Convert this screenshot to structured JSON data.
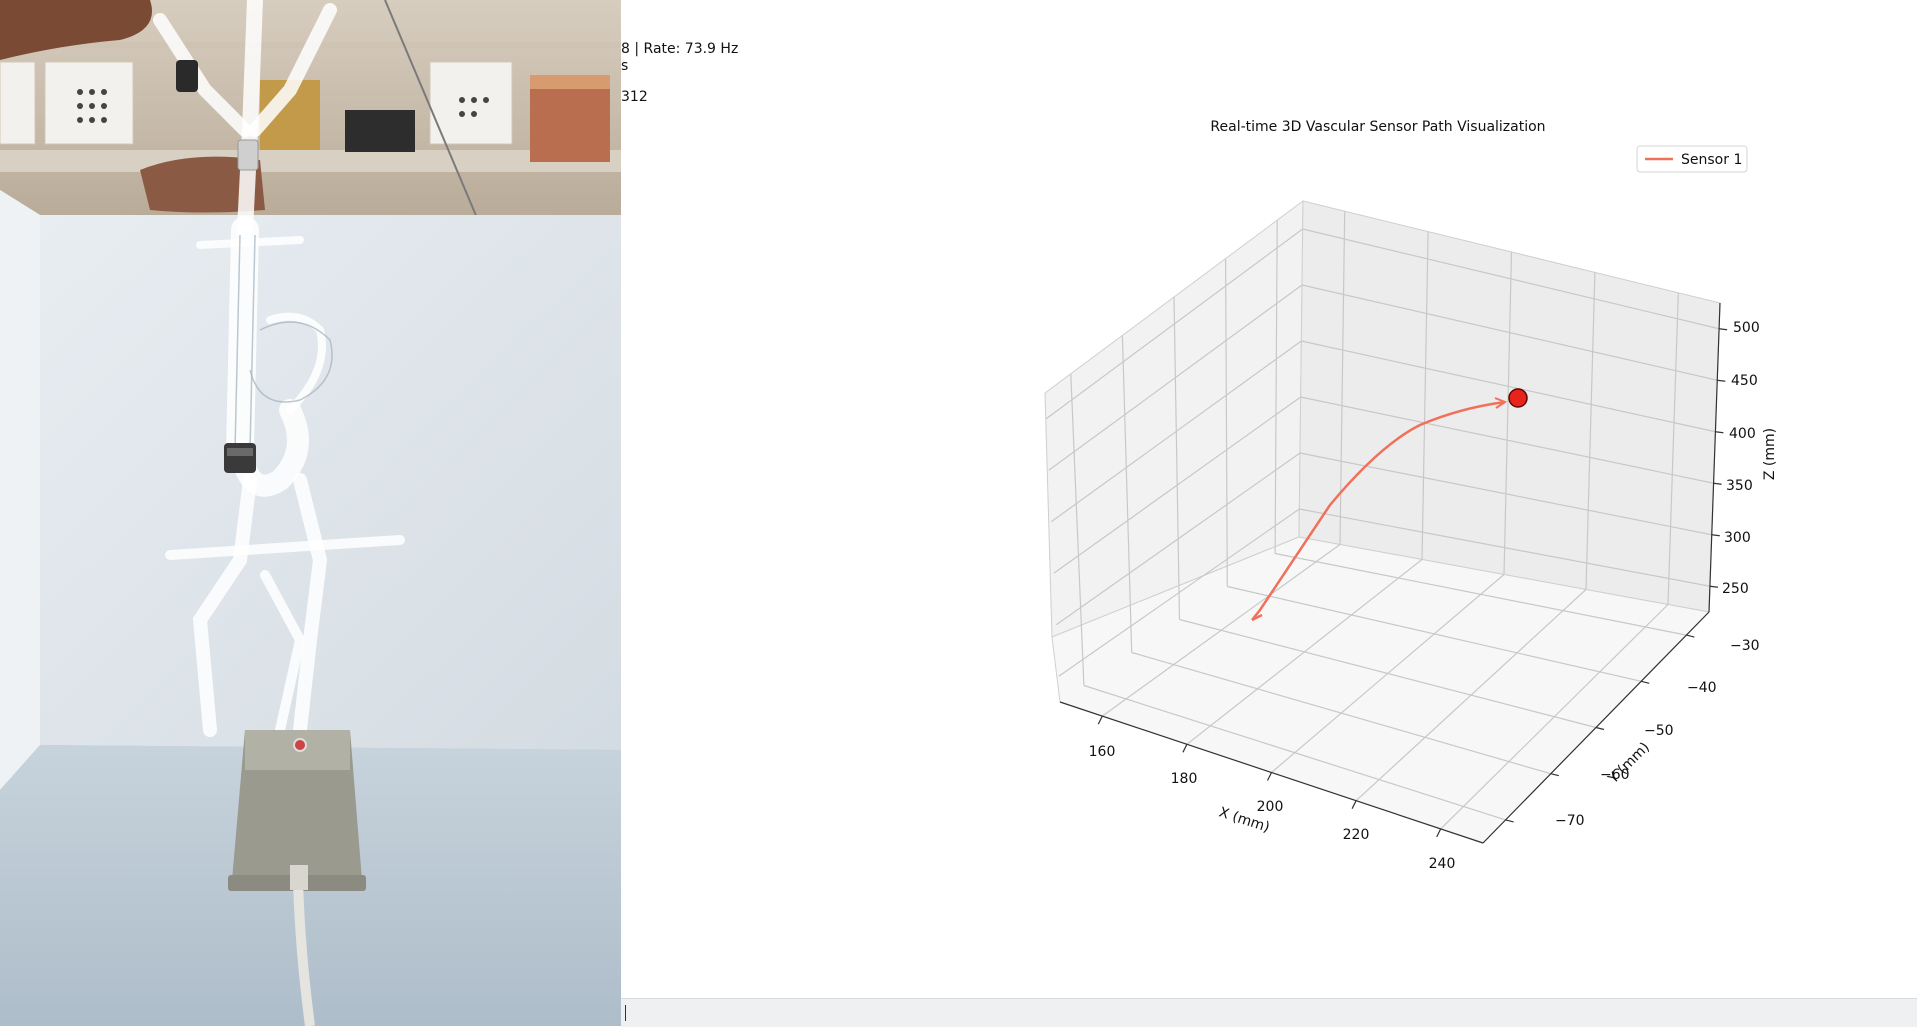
{
  "status": {
    "line1": "8 | Rate: 73.9 Hz",
    "line2": "s",
    "line3": "312"
  },
  "chart_data": {
    "type": "line3d",
    "title": "Real-time 3D Vascular Sensor Path Visualization",
    "legend": {
      "position": "upper-right",
      "entries": [
        "Sensor 1"
      ]
    },
    "xlabel": "X (mm)",
    "ylabel": "Y (mm)",
    "zlabel": "Z (mm)",
    "xticks": [
      "160",
      "180",
      "200",
      "220",
      "240"
    ],
    "yticks": [
      "−30",
      "−40",
      "−50",
      "−60",
      "−70"
    ],
    "zticks": [
      "250",
      "300",
      "350",
      "400",
      "450",
      "500"
    ],
    "series": [
      {
        "name": "Sensor 1",
        "color": "#f0705a",
        "current_marker_color": "#e8241a"
      }
    ],
    "grid": true
  }
}
